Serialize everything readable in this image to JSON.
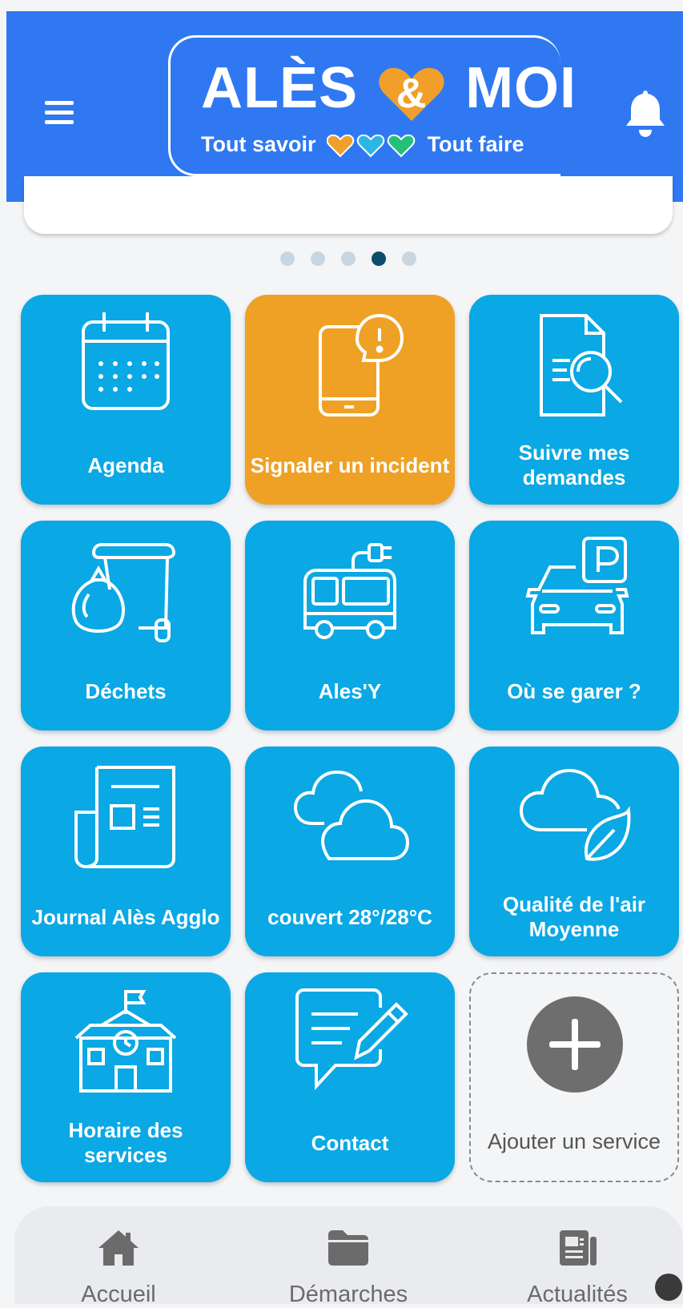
{
  "header": {
    "logo_title_left": "ALÈS",
    "logo_amp": "&",
    "logo_title_right": "MOI",
    "logo_sub_left": "Tout savoir",
    "logo_sub_right": "Tout faire",
    "menu_icon": "hamburger-menu-icon",
    "bell_icon": "bell-icon",
    "colors": {
      "bar": "#2f78f2",
      "heart_orange": "#f0a02a",
      "heart_blue": "#2bb6e6",
      "heart_green": "#23c07a"
    }
  },
  "carousel": {
    "page_count": 5,
    "active_index": 3
  },
  "tiles": [
    {
      "label": "Agenda",
      "icon": "calendar-icon"
    },
    {
      "label": "Signaler un incident",
      "icon": "phone-alert-icon",
      "color": "#efa125"
    },
    {
      "label": "Suivre mes demandes",
      "icon": "document-search-icon"
    },
    {
      "label": "Déchets",
      "icon": "trash-bin-icon"
    },
    {
      "label": "Ales'Y",
      "icon": "electric-bus-icon"
    },
    {
      "label": "Où se garer ?",
      "icon": "car-parking-icon"
    },
    {
      "label": "Journal Alès Agglo",
      "icon": "newspaper-icon"
    },
    {
      "label": "couvert 28°/28°C",
      "icon": "clouds-icon"
    },
    {
      "label": "Qualité de l'air Moyenne",
      "icon": "cloud-leaf-icon"
    },
    {
      "label": "Horaire des services",
      "icon": "town-hall-icon"
    },
    {
      "label": "Contact",
      "icon": "message-edit-icon"
    },
    {
      "label": "Ajouter un service",
      "icon": "plus-icon"
    }
  ],
  "bottom_nav": [
    {
      "label": "Accueil",
      "icon": "home-icon"
    },
    {
      "label": "Démarches",
      "icon": "folder-icon"
    },
    {
      "label": "Actualités",
      "icon": "news-icon"
    }
  ],
  "tile_color": "#0aa8e4"
}
